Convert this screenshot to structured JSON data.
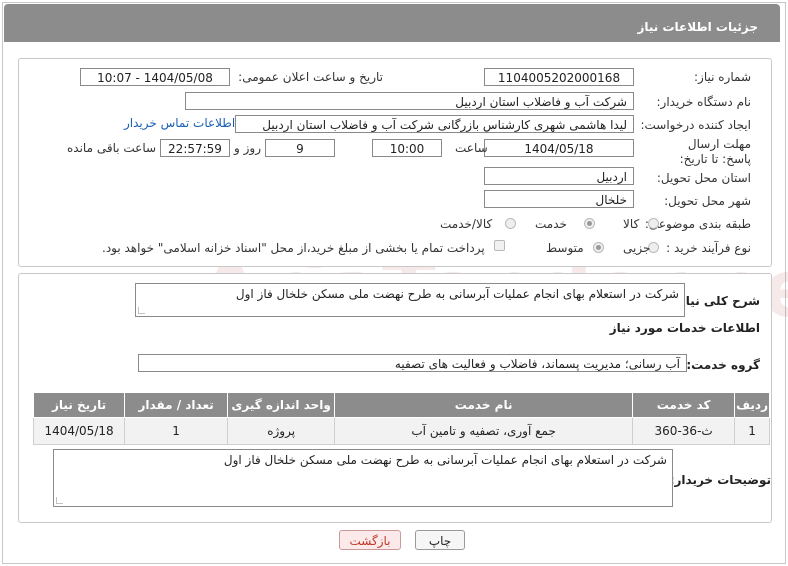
{
  "header": {
    "title": "جزئیات اطلاعات نیاز"
  },
  "form": {
    "need_number_label": "شماره نیاز:",
    "need_number": "1104005202000168",
    "announce_label": "تاریخ و ساعت اعلان عمومی:",
    "announce_value": "1404/05/08 - 10:07",
    "buyer_org_label": "نام دستگاه خریدار:",
    "buyer_org": "شرکت آب و فاضلاب استان اردبیل",
    "creator_label": "ایجاد کننده درخواست:",
    "creator": "لیدا  هاشمی شهری کارشناس بازرگانی شرکت آب و فاضلاب استان اردبیل",
    "contact_link": "اطلاعات تماس خریدار",
    "deadline_label": "مهلت ارسال پاسخ: تا تاریخ:",
    "deadline_date": "1404/05/18",
    "time_label": "ساعت",
    "deadline_time": "10:00",
    "days_value": "9",
    "days_label": "روز و",
    "remaining_time": "22:57:59",
    "remaining_label": "ساعت باقی مانده",
    "province_label": "استان محل تحویل:",
    "province": "اردبیل",
    "city_label": "شهر محل تحویل:",
    "city": "خلخال",
    "category_label": "طبقه بندی موضوعی:",
    "category_options": [
      "کالا",
      "خدمت",
      "کالا/خدمت"
    ],
    "category_selected": "خدمت",
    "process_label": "نوع فرآیند خرید :",
    "process_options": [
      "جزیی",
      "متوسط"
    ],
    "process_selected": "متوسط",
    "treasury_note": "پرداخت تمام یا بخشی از مبلغ خرید،از محل \"اسناد خزانه اسلامی\" خواهد بود."
  },
  "summary": {
    "label": "شرح کلی نیاز:",
    "text": "شرکت در استعلام بهای انجام عملیات آبرسانی به طرح نهضت ملی مسکن  خلخال فاز اول"
  },
  "services": {
    "section_title": "اطلاعات خدمات مورد نیاز",
    "group_label": "گروه خدمت:",
    "group_value": "آب رسانی؛ مدیریت پسماند، فاضلاب و فعالیت های تصفیه",
    "columns": [
      "ردیف",
      "کد خدمت",
      "نام خدمت",
      "واحد اندازه گیری",
      "تعداد / مقدار",
      "تاریخ نیاز"
    ],
    "rows": [
      {
        "row": "1",
        "code": "ث-36-360",
        "name": "جمع آوری، تصفیه و تامین آب",
        "unit": "پروژه",
        "qty": "1",
        "date": "1404/05/18"
      }
    ]
  },
  "buyer_notes": {
    "label": "توضیحات خریدار:",
    "text": "شرکت در استعلام بهای انجام عملیات آبرسانی به طرح نهضت ملی مسکن  خلخال فاز اول"
  },
  "buttons": {
    "print": "چاپ",
    "back": "بازگشت"
  },
  "watermark": "AriaTender.net"
}
